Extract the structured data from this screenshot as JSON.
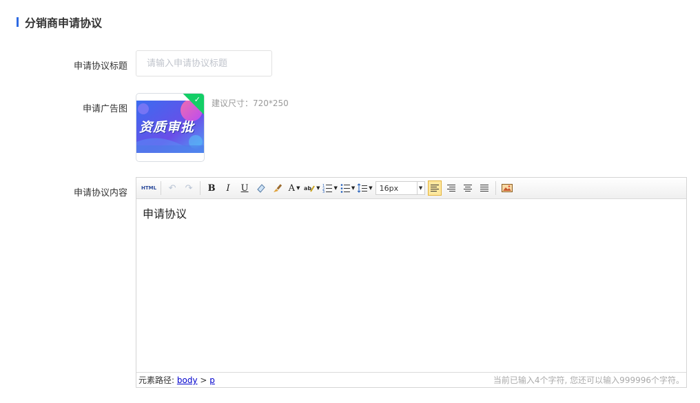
{
  "section": {
    "title": "分销商申请协议"
  },
  "form": {
    "title_label": "申请协议标题",
    "title_placeholder": "请输入申请协议标题",
    "title_value": "",
    "image_label": "申请广告图",
    "image_text": "资质审批",
    "image_hint": "建议尺寸：720*250",
    "content_label": "申请协议内容"
  },
  "editor": {
    "toolbar": {
      "html": "HTML",
      "bold": "B",
      "italic": "I",
      "underline": "U",
      "fontcolor": "A",
      "fontsize": "16px",
      "icons": [
        "undo-icon",
        "redo-icon",
        "bold-icon",
        "italic-icon",
        "underline-icon",
        "eraser-icon",
        "format-brush-icon",
        "font-color-icon",
        "highlight-icon",
        "ordered-list-icon",
        "unordered-list-icon",
        "line-height-icon",
        "align-left-icon",
        "align-right-icon",
        "align-center-icon",
        "justify-icon",
        "image-icon"
      ]
    },
    "content": "申请协议",
    "path_label": "元素路径:",
    "path_body": "body",
    "path_sep": ">",
    "path_p": "p",
    "word_count": "当前已输入4个字符, 您还可以输入999996个字符。"
  },
  "colors": {
    "accent": "#2d6ae3",
    "check": "#13ce66",
    "active_btn": "#fde79e"
  }
}
